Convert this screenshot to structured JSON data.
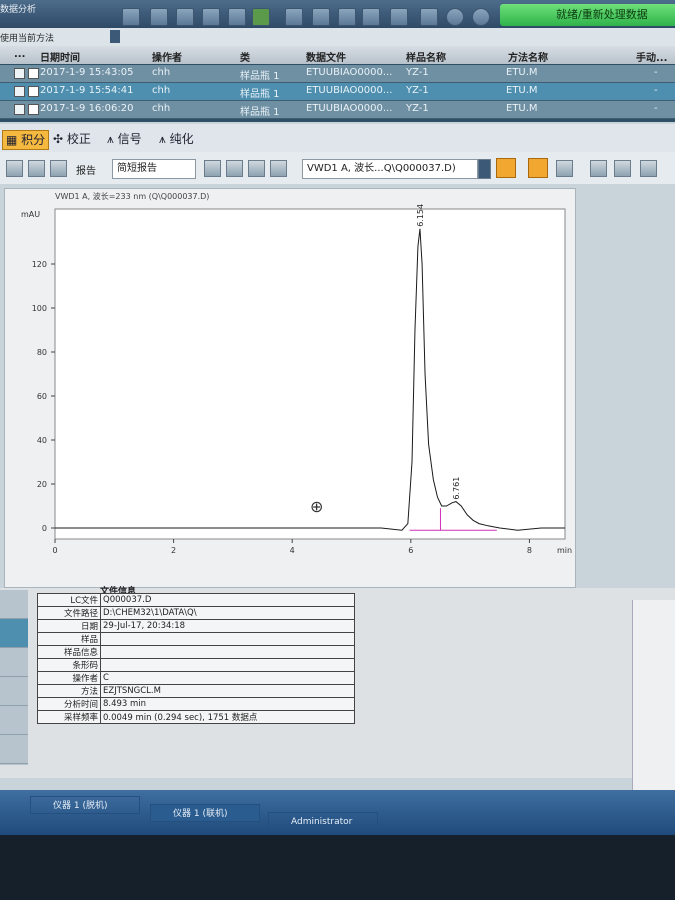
{
  "app": {
    "title": "数据分析",
    "status": "就绪/重新处理数据"
  },
  "method_bar": {
    "label": "使用当前方法"
  },
  "sequence_table": {
    "columns": [
      "...",
      "日期时间",
      "操作者",
      "类",
      "数据文件",
      "样品名称",
      "方法名称",
      "手动..."
    ],
    "rows": [
      {
        "datetime": "2017-1-9 15:43:05",
        "operator": "chh",
        "type": "样品瓶 1",
        "file": "ETUUBIAO0000...",
        "sample": "YZ-1",
        "method": "ETU.M",
        "manual": "-"
      },
      {
        "datetime": "2017-1-9 15:54:41",
        "operator": "chh",
        "type": "样品瓶 1",
        "file": "ETUUBIAO0000...",
        "sample": "YZ-1",
        "method": "ETU.M",
        "manual": "-"
      },
      {
        "datetime": "2017-1-9 16:06:20",
        "operator": "chh",
        "type": "样品瓶 1",
        "file": "ETUUBIAO0000...",
        "sample": "YZ-1",
        "method": "ETU.M",
        "manual": "-"
      }
    ]
  },
  "tabs": [
    "积分",
    "校正",
    "信号",
    "纯化"
  ],
  "toolbar": {
    "report_label": "报告",
    "report_value": "简短报告",
    "signal_select": "VWD1 A, 波长...Q\\Q000037.D)"
  },
  "chart_data": {
    "type": "line",
    "title": "VWD1 A, 波长=233 nm (Q\\Q000037.D)",
    "ylabel": "mAU",
    "xlabel": "min",
    "xlim": [
      0,
      8.6
    ],
    "ylim": [
      -5,
      145
    ],
    "xticks": [
      0,
      2,
      4,
      6,
      8
    ],
    "yticks": [
      0,
      20,
      40,
      60,
      80,
      100,
      120
    ],
    "peaks": [
      {
        "label": "6.154",
        "x": 6.154,
        "y": 136
      },
      {
        "label": "6.761",
        "x": 6.761,
        "y": 12
      }
    ],
    "x": [
      0,
      5.5,
      5.85,
      5.95,
      6.02,
      6.07,
      6.12,
      6.154,
      6.19,
      6.24,
      6.3,
      6.38,
      6.45,
      6.52,
      6.6,
      6.7,
      6.761,
      6.85,
      6.95,
      7.05,
      7.15,
      7.3,
      7.5,
      7.8,
      8.2,
      8.6
    ],
    "values": [
      0,
      0,
      -1,
      2,
      30,
      90,
      128,
      136,
      120,
      70,
      38,
      22,
      14,
      10,
      10,
      11.5,
      12,
      10,
      6,
      3.5,
      2,
      1,
      0,
      -1,
      0,
      0
    ]
  },
  "file_info": {
    "title": "文件信息",
    "rows": [
      {
        "key": "LC文件",
        "value": "Q000037.D"
      },
      {
        "key": "文件路径",
        "value": "D:\\CHEM32\\1\\DATA\\Q\\"
      },
      {
        "key": "日期",
        "value": "29-Jul-17, 20:34:18"
      },
      {
        "key": "样品",
        "value": ""
      },
      {
        "key": "样品信息",
        "value": ""
      },
      {
        "key": "条形码",
        "value": ""
      },
      {
        "key": "操作者",
        "value": "C"
      },
      {
        "key": "方法",
        "value": "EZJTSNGCL.M"
      },
      {
        "key": "分析时间",
        "value": "8.493 min"
      },
      {
        "key": "采样频率",
        "value": "0.0049 min (0.294 sec), 1751 数据点"
      }
    ]
  },
  "taskbar": {
    "items": [
      "仪器 1 (联机)",
      "仪器 1 (脱机)",
      "Administrator"
    ]
  },
  "colors": {
    "accent": "#f6b940",
    "status_green": "#2fb24a",
    "baseline": "#d02fb8",
    "trace": "#1a1a1a"
  }
}
